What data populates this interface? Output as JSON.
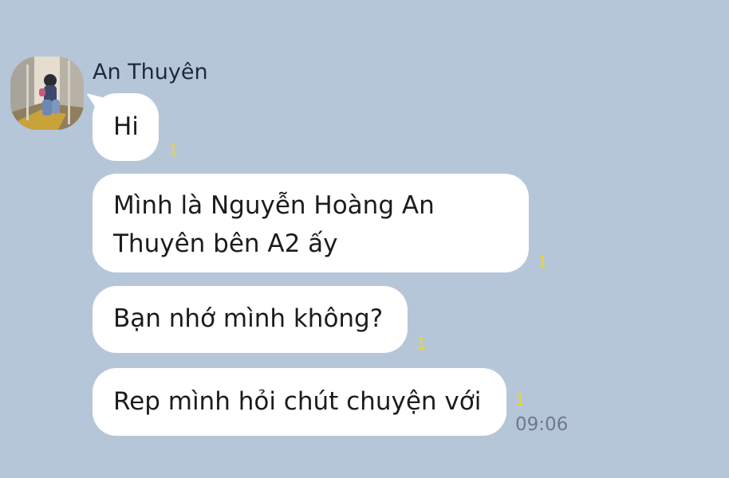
{
  "conversation": {
    "sender": {
      "name": "An Thuyên"
    },
    "messages": [
      {
        "text_lines": [
          "Hi"
        ],
        "unread_count": "1"
      },
      {
        "text_lines": [
          "Mình là Nguyễn Hoàng An",
          "Thuyên bên A2 ấy"
        ],
        "unread_count": "1"
      },
      {
        "text_lines": [
          "Bạn nhớ mình không?"
        ],
        "unread_count": "1"
      },
      {
        "text_lines": [
          "Rep mình hỏi chút chuyện với"
        ],
        "unread_count": "1",
        "time": "09:06"
      }
    ]
  },
  "colors": {
    "background": "#b6c6d9",
    "bubble": "#ffffff",
    "unread_count": "#e8d438",
    "timestamp": "#6c7a8c"
  },
  "icons": {
    "avatar": "profile-photo"
  }
}
